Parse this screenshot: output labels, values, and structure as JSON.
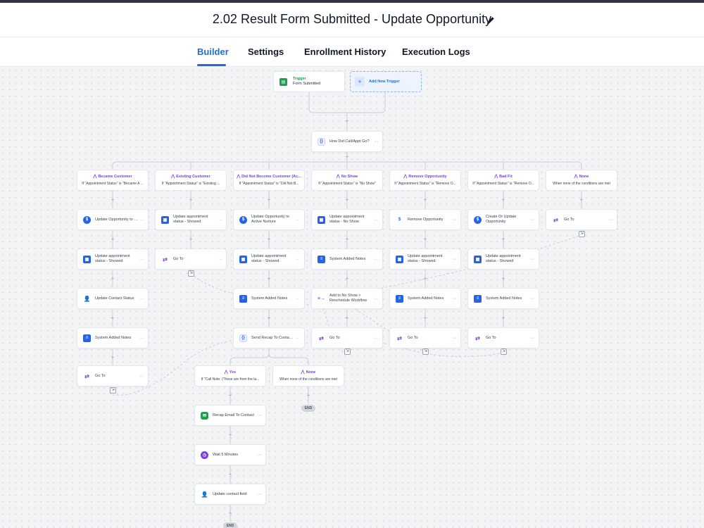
{
  "header": {
    "title": "2.02 Result Form Submitted - Update Opportunity"
  },
  "tabs": [
    {
      "label": "Builder",
      "active": true
    },
    {
      "label": "Settings",
      "active": false
    },
    {
      "label": "Enrollment History",
      "active": false
    },
    {
      "label": "Execution Logs",
      "active": false
    }
  ],
  "colors": {
    "accent": "#1d6fd6",
    "branch": "#7c3aed",
    "trigger": "#16a34a"
  },
  "trigger": {
    "heading": "Trigger",
    "name": "Form Submitted",
    "add_label": "Add New Trigger"
  },
  "condition_node": {
    "label": "How Did Call/Appt Go?",
    "icon": "condition-icon"
  },
  "branches": [
    {
      "name": "Became Customer",
      "condition": "If \"Appointment Status\" is \"Became A ..."
    },
    {
      "name": "Existing Customer",
      "condition": "If \"Appointment Status\" is \"Existing ..."
    },
    {
      "name": "Did Not Become Customer (Ac...",
      "condition": "If \"Appointment Status\" is \"Did Not B..."
    },
    {
      "name": "No Show",
      "condition": "If \"Appointment Status\" is \"No Show\""
    },
    {
      "name": "Remove Opportunity",
      "condition": "If \"Appointment Status\" is \"Remove O..."
    },
    {
      "name": "Bad Fit",
      "condition": "If \"Appointment Status\" is \"Remove O..."
    },
    {
      "name": "None",
      "condition": "When none of the conditions are met"
    }
  ],
  "actions": {
    "c1": [
      "Update Opportunity to Wo...",
      "Update appointment status - Showed",
      "Update Contact Status",
      "System Added Notes",
      "Go To"
    ],
    "c2": [
      "Update appointment status - Showed",
      "Go To"
    ],
    "c3": [
      "Update Opportunity to Active Nurture",
      "Update appointment status - Showed",
      "System Added Notes",
      "Send Recap To Contact?"
    ],
    "c4": [
      "Update appointment status - No Show",
      "System Added Notes",
      "Add to No Show > Reschedule Workflow",
      "Go To"
    ],
    "c5": [
      "Remove Opportunity",
      "Update appointment status - Showed",
      "System Added Notes",
      "Go To"
    ],
    "c6": [
      "Create Or Update Opportunity",
      "Update appointment status - Showed",
      "System Added Notes",
      "Go To"
    ],
    "c7": [
      "Go To"
    ]
  },
  "sub_branches": [
    {
      "name": "Yes",
      "condition": "If \"Call Note: (These are from the la..."
    },
    {
      "name": "None",
      "condition": "When none of the conditions are met"
    }
  ],
  "yes_actions": [
    "Recap Email To Contact",
    "Wait 5 Minutes",
    "Update contact field"
  ],
  "end_label": "END",
  "icons": [
    "pencil-icon",
    "clipboard-icon",
    "plus-icon",
    "condition-icon",
    "branch-icon",
    "dollar-icon",
    "calendar-icon",
    "user-icon",
    "notes-icon",
    "goto-icon",
    "workflow-icon",
    "email-icon",
    "clock-icon",
    "more-icon"
  ]
}
